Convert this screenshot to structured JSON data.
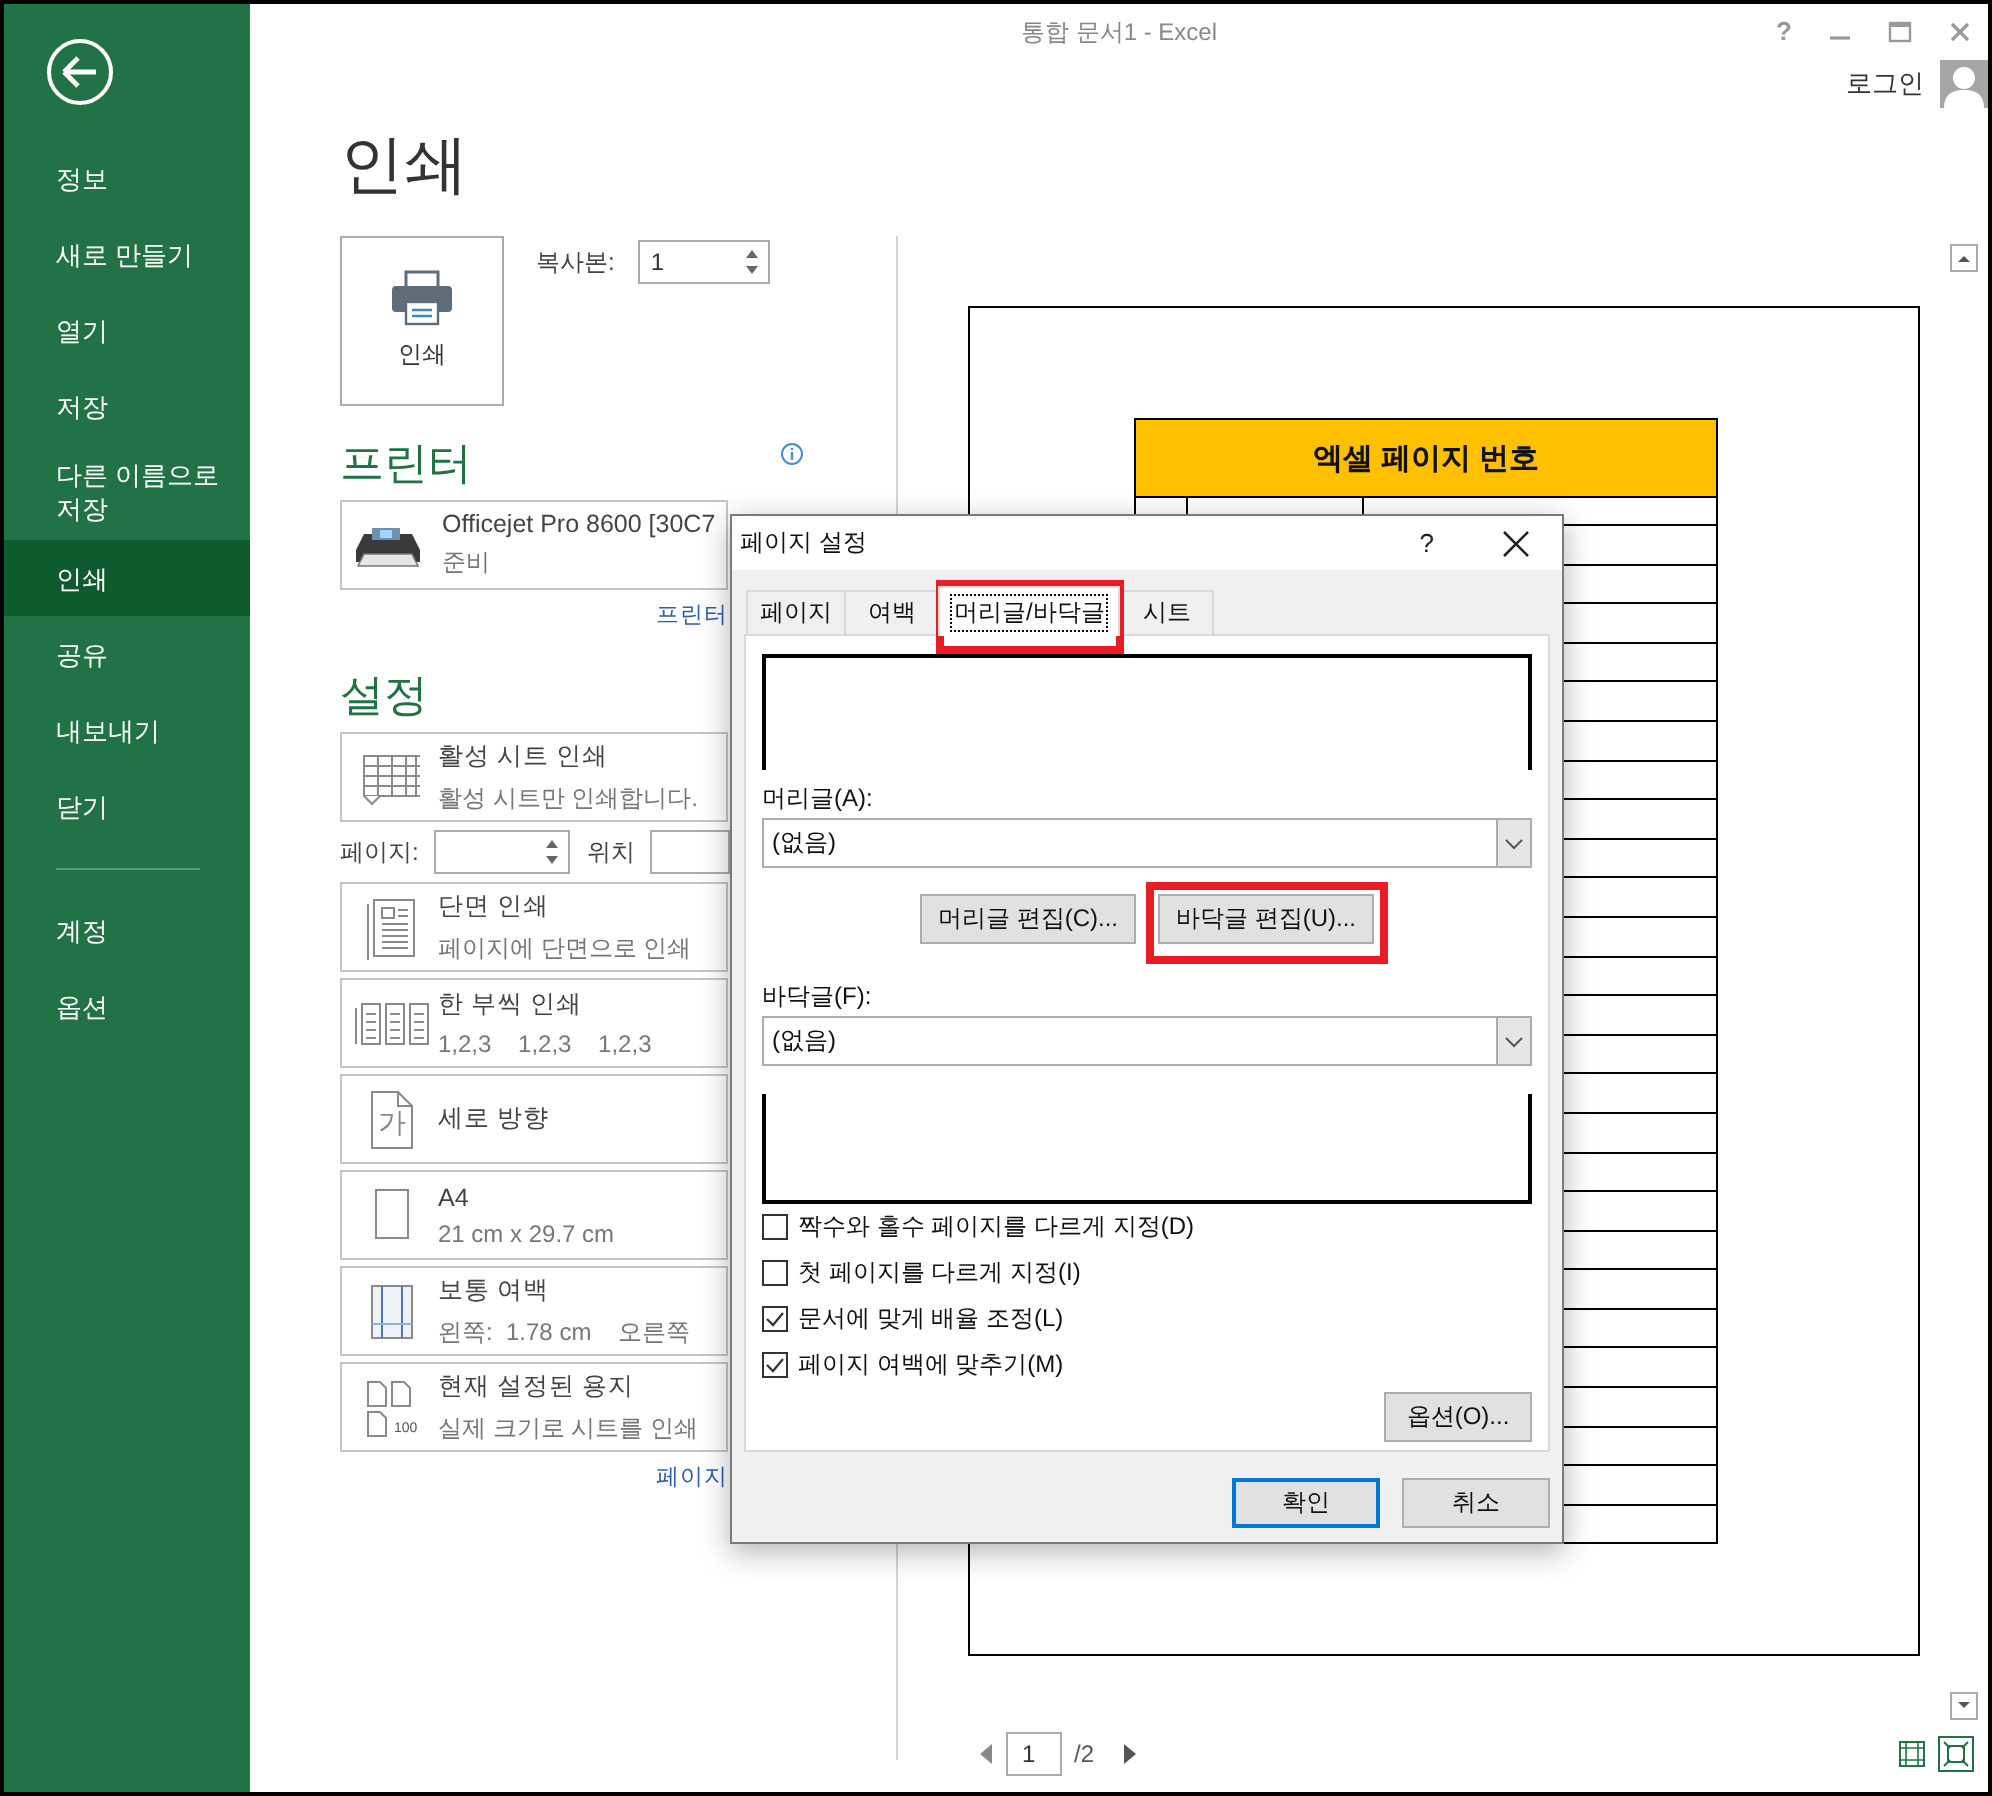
{
  "window": {
    "title": "통합 문서1 - Excel",
    "help": "?"
  },
  "account": {
    "label": "로그인"
  },
  "sidebar": {
    "items": [
      {
        "label": "정보",
        "selected": false
      },
      {
        "label": "새로 만들기",
        "selected": false
      },
      {
        "label": "열기",
        "selected": false
      },
      {
        "label": "저장",
        "selected": false
      },
      {
        "label": "다른 이름으로 저장",
        "selected": false
      },
      {
        "label": "인쇄",
        "selected": true
      },
      {
        "label": "공유",
        "selected": false
      },
      {
        "label": "내보내기",
        "selected": false
      },
      {
        "label": "닫기",
        "selected": false
      }
    ],
    "footer_items": [
      {
        "label": "계정",
        "selected": false
      },
      {
        "label": "옵션",
        "selected": false
      }
    ]
  },
  "page_title": "인쇄",
  "print_button": {
    "label": "인쇄"
  },
  "copies": {
    "label": "복사본:",
    "value": "1"
  },
  "printer": {
    "heading": "프린터",
    "name": "Officejet Pro 8600 [30C7",
    "status": "준비",
    "properties_link": "프린터"
  },
  "settings": {
    "heading": "설정",
    "options": [
      {
        "kind": "option",
        "title": "활성 시트 인쇄",
        "subtitle": "활성 시트만 인쇄합니다."
      },
      {
        "kind": "pages",
        "label": "페이지:",
        "to_label": "위치"
      },
      {
        "kind": "option",
        "title": "단면 인쇄",
        "subtitle": "페이지에 단면으로 인쇄"
      },
      {
        "kind": "option",
        "title": "한 부씩 인쇄",
        "subtitle": "1,2,3    1,2,3    1,2,3"
      },
      {
        "kind": "option",
        "icon_text": "가",
        "title": "세로 방향"
      },
      {
        "kind": "option",
        "title": "A4",
        "subtitle": "21 cm x 29.7 cm"
      },
      {
        "kind": "option",
        "title": "보통 여백",
        "subtitle": "왼쪽:  1.78 cm    오른쪽"
      },
      {
        "kind": "option",
        "icon_text": "100",
        "title": "현재 설정된 용지",
        "subtitle": "실제 크기로 시트를 인쇄"
      }
    ],
    "page_setup_link": "페이지"
  },
  "preview": {
    "title": "엑셀 페이지 번호",
    "page": "1",
    "total": "/2"
  },
  "dialog": {
    "title": "페이지 설정",
    "help": "?",
    "tabs": [
      {
        "label": "페이지",
        "selected": false,
        "highlighted": false
      },
      {
        "label": "여백",
        "selected": false,
        "highlighted": false
      },
      {
        "label": "머리글/바닥글",
        "selected": true,
        "highlighted": true
      },
      {
        "label": "시트",
        "selected": false,
        "highlighted": false
      }
    ],
    "header": {
      "label": "머리글(A):",
      "value": "(없음)"
    },
    "buttons": [
      {
        "label": "머리글 편집(C)...",
        "highlighted": false
      },
      {
        "label": "바닥글 편집(U)...",
        "highlighted": true
      }
    ],
    "footer": {
      "label": "바닥글(F):",
      "value": "(없음)"
    },
    "checkboxes": [
      {
        "label": "짝수와 홀수 페이지를 다르게 지정(D)",
        "checked": false
      },
      {
        "label": "첫 페이지를 다르게 지정(I)",
        "checked": false
      },
      {
        "label": "문서에 맞게 배율 조정(L)",
        "checked": true
      },
      {
        "label": "페이지 여백에 맞추기(M)",
        "checked": true
      }
    ],
    "options_button": "옵션(O)...",
    "ok": "확인",
    "cancel": "취소"
  }
}
